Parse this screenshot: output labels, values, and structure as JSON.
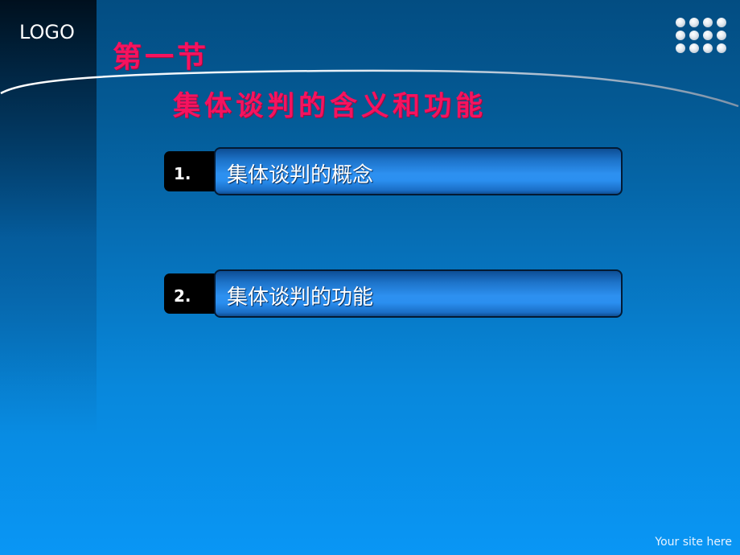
{
  "header": {
    "logo_text": "LOGO",
    "section_label": "第一节",
    "title": "集体谈判的含义和功能"
  },
  "items": [
    {
      "number": "1.",
      "label": "集体谈判的概念"
    },
    {
      "number": "2.",
      "label": "集体谈判的功能"
    }
  ],
  "footer": {
    "site_text": "Your site here"
  },
  "icons": {
    "decoration": "dot-grid-icon"
  },
  "colors": {
    "title": "#f5135f",
    "background_top": "#034d82",
    "background_bottom": "#0996f5",
    "bar": "#2d90f0"
  }
}
